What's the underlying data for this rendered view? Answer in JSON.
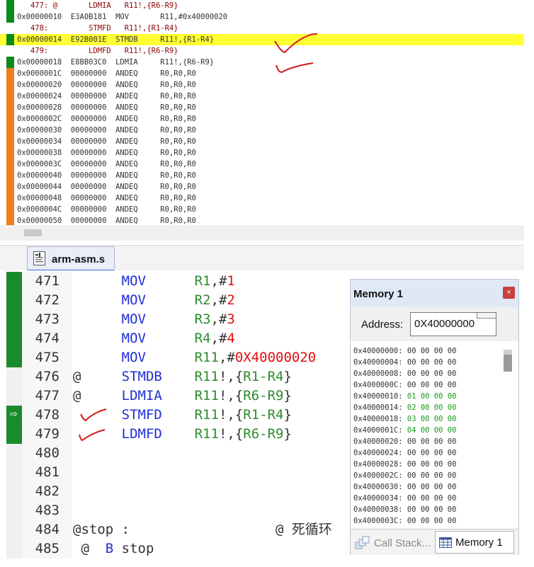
{
  "disassembly": {
    "lines": [
      {
        "text": "   477: @       LDMIA   R11!,{R6-R9}",
        "kind": "src",
        "gutter": "#0a8a1a"
      },
      {
        "text": "0x00000010  E3A0B181  MOV       R11,#0x40000020",
        "kind": "asm",
        "gutter": "#0a8a1a"
      },
      {
        "text": "   478:         STMFD   R11!,{R1-R4}",
        "kind": "src",
        "gutter": ""
      },
      {
        "text": "0x00000014  E92B001E  STMDB     R11!,{R1-R4}",
        "kind": "cur",
        "gutter": "#0a8a1a"
      },
      {
        "text": "   479:         LDMFD   R11!,{R6-R9}",
        "kind": "src",
        "gutter": ""
      },
      {
        "text": "0x00000018  E8BB03C0  LDMIA     R11!,{R6-R9}",
        "kind": "asm",
        "gutter": "#0a8a1a"
      },
      {
        "text": "0x0000001C  00000000  ANDEQ     R0,R0,R0",
        "kind": "asm",
        "gutter": "#f07d1a"
      },
      {
        "text": "0x00000020  00000000  ANDEQ     R0,R0,R0",
        "kind": "asm",
        "gutter": "#f07d1a"
      },
      {
        "text": "0x00000024  00000000  ANDEQ     R0,R0,R0",
        "kind": "asm",
        "gutter": "#f07d1a"
      },
      {
        "text": "0x00000028  00000000  ANDEQ     R0,R0,R0",
        "kind": "asm",
        "gutter": "#f07d1a"
      },
      {
        "text": "0x0000002C  00000000  ANDEQ     R0,R0,R0",
        "kind": "asm",
        "gutter": "#f07d1a"
      },
      {
        "text": "0x00000030  00000000  ANDEQ     R0,R0,R0",
        "kind": "asm",
        "gutter": "#f07d1a"
      },
      {
        "text": "0x00000034  00000000  ANDEQ     R0,R0,R0",
        "kind": "asm",
        "gutter": "#f07d1a"
      },
      {
        "text": "0x00000038  00000000  ANDEQ     R0,R0,R0",
        "kind": "asm",
        "gutter": "#f07d1a"
      },
      {
        "text": "0x0000003C  00000000  ANDEQ     R0,R0,R0",
        "kind": "asm",
        "gutter": "#f07d1a"
      },
      {
        "text": "0x00000040  00000000  ANDEQ     R0,R0,R0",
        "kind": "asm",
        "gutter": "#f07d1a"
      },
      {
        "text": "0x00000044  00000000  ANDEQ     R0,R0,R0",
        "kind": "asm",
        "gutter": "#f07d1a"
      },
      {
        "text": "0x00000048  00000000  ANDEQ     R0,R0,R0",
        "kind": "asm",
        "gutter": "#f07d1a"
      },
      {
        "text": "0x0000004C  00000000  ANDEQ     R0,R0,R0",
        "kind": "asm",
        "gutter": "#f07d1a"
      },
      {
        "text": "0x00000050  00000000  ANDEQ     R0,R0,R0",
        "kind": "asm",
        "gutter": "#f07d1a"
      }
    ]
  },
  "tabs": {
    "active_file": "arm-asm.s"
  },
  "editor": {
    "lines": [
      {
        "num": "471",
        "gutter": "green",
        "arrow": false,
        "tokens": [
          [
            "      ",
            "plain"
          ],
          [
            "MOV",
            "kw"
          ],
          [
            "      ",
            "plain"
          ],
          [
            "R1",
            "reg"
          ],
          [
            ",#",
            "plain"
          ],
          [
            "1",
            "num"
          ]
        ]
      },
      {
        "num": "472",
        "gutter": "green",
        "arrow": false,
        "tokens": [
          [
            "      ",
            "plain"
          ],
          [
            "MOV",
            "kw"
          ],
          [
            "      ",
            "plain"
          ],
          [
            "R2",
            "reg"
          ],
          [
            ",#",
            "plain"
          ],
          [
            "2",
            "num"
          ]
        ]
      },
      {
        "num": "473",
        "gutter": "green",
        "arrow": false,
        "tokens": [
          [
            "      ",
            "plain"
          ],
          [
            "MOV",
            "kw"
          ],
          [
            "      ",
            "plain"
          ],
          [
            "R3",
            "reg"
          ],
          [
            ",#",
            "plain"
          ],
          [
            "3",
            "num"
          ]
        ]
      },
      {
        "num": "474",
        "gutter": "green",
        "arrow": false,
        "tokens": [
          [
            "      ",
            "plain"
          ],
          [
            "MOV",
            "kw"
          ],
          [
            "      ",
            "plain"
          ],
          [
            "R4",
            "reg"
          ],
          [
            ",#",
            "plain"
          ],
          [
            "4",
            "num"
          ]
        ]
      },
      {
        "num": "475",
        "gutter": "green",
        "arrow": false,
        "tokens": [
          [
            "      ",
            "plain"
          ],
          [
            "MOV",
            "kw"
          ],
          [
            "      ",
            "plain"
          ],
          [
            "R11",
            "reg"
          ],
          [
            ",#",
            "plain"
          ],
          [
            "0X40000020",
            "num"
          ]
        ]
      },
      {
        "num": "476",
        "gutter": "none",
        "arrow": false,
        "tokens": [
          [
            "@     ",
            "plain"
          ],
          [
            "STMDB",
            "kw"
          ],
          [
            "    ",
            "plain"
          ],
          [
            "R11",
            "reg"
          ],
          [
            "!,{",
            "plain"
          ],
          [
            "R1-R4",
            "reg"
          ],
          [
            "}",
            "plain"
          ]
        ]
      },
      {
        "num": "477",
        "gutter": "none",
        "arrow": false,
        "tokens": [
          [
            "@     ",
            "plain"
          ],
          [
            "LDMIA",
            "kw"
          ],
          [
            "    ",
            "plain"
          ],
          [
            "R11",
            "reg"
          ],
          [
            "!,{",
            "plain"
          ],
          [
            "R6-R9",
            "reg"
          ],
          [
            "}",
            "plain"
          ]
        ]
      },
      {
        "num": "478",
        "gutter": "green",
        "arrow": true,
        "tokens": [
          [
            "      ",
            "plain"
          ],
          [
            "STMFD",
            "kw"
          ],
          [
            "    ",
            "plain"
          ],
          [
            "R11",
            "reg"
          ],
          [
            "!,{",
            "plain"
          ],
          [
            "R1-R4",
            "reg"
          ],
          [
            "}",
            "plain"
          ]
        ]
      },
      {
        "num": "479",
        "gutter": "green",
        "arrow": false,
        "tokens": [
          [
            "      ",
            "plain"
          ],
          [
            "LDMFD",
            "kw"
          ],
          [
            "    ",
            "plain"
          ],
          [
            "R11",
            "reg"
          ],
          [
            "!,{",
            "plain"
          ],
          [
            "R6-R9",
            "reg"
          ],
          [
            "}",
            "plain"
          ]
        ]
      },
      {
        "num": "480",
        "gutter": "none",
        "arrow": false,
        "tokens": []
      },
      {
        "num": "481",
        "gutter": "none",
        "arrow": false,
        "tokens": []
      },
      {
        "num": "482",
        "gutter": "none",
        "arrow": false,
        "tokens": []
      },
      {
        "num": "483",
        "gutter": "none",
        "arrow": false,
        "tokens": []
      },
      {
        "num": "484",
        "gutter": "none",
        "arrow": false,
        "tokens": [
          [
            "@stop :",
            "plain"
          ],
          [
            "                  @ 死循环",
            "cmt"
          ]
        ]
      },
      {
        "num": "485",
        "gutter": "none",
        "arrow": false,
        "tokens": [
          [
            " @  ",
            "plain"
          ],
          [
            "B",
            "kw"
          ],
          [
            " stop",
            "plain"
          ]
        ]
      }
    ]
  },
  "memory": {
    "title": "Memory 1",
    "close_label": "×",
    "address_label": "Address:",
    "address_value": "0X40000000",
    "lines": [
      {
        "addr": "0x40000000:",
        "bytes": "00 00 00 00",
        "changed": false
      },
      {
        "addr": "0x40000004:",
        "bytes": "00 00 00 00",
        "changed": false
      },
      {
        "addr": "0x40000008:",
        "bytes": "00 00 00 00",
        "changed": false
      },
      {
        "addr": "0x4000000C:",
        "bytes": "00 00 00 00",
        "changed": false
      },
      {
        "addr": "0x40000010:",
        "bytes": "01 00 00 00",
        "changed": true
      },
      {
        "addr": "0x40000014:",
        "bytes": "02 00 00 00",
        "changed": true
      },
      {
        "addr": "0x40000018:",
        "bytes": "03 00 00 00",
        "changed": true
      },
      {
        "addr": "0x4000001C:",
        "bytes": "04 00 00 00",
        "changed": true
      },
      {
        "addr": "0x40000020:",
        "bytes": "00 00 00 00",
        "changed": false
      },
      {
        "addr": "0x40000024:",
        "bytes": "00 00 00 00",
        "changed": false
      },
      {
        "addr": "0x40000028:",
        "bytes": "00 00 00 00",
        "changed": false
      },
      {
        "addr": "0x4000002C:",
        "bytes": "00 00 00 00",
        "changed": false
      },
      {
        "addr": "0x40000030:",
        "bytes": "00 00 00 00",
        "changed": false
      },
      {
        "addr": "0x40000034:",
        "bytes": "00 00 00 00",
        "changed": false
      },
      {
        "addr": "0x40000038:",
        "bytes": "00 00 00 00",
        "changed": false
      },
      {
        "addr": "0x4000003C:",
        "bytes": "00 00 00 00",
        "changed": false
      }
    ],
    "tabs": {
      "callstack": "Call Stack...",
      "memory1": "Memory 1"
    }
  }
}
